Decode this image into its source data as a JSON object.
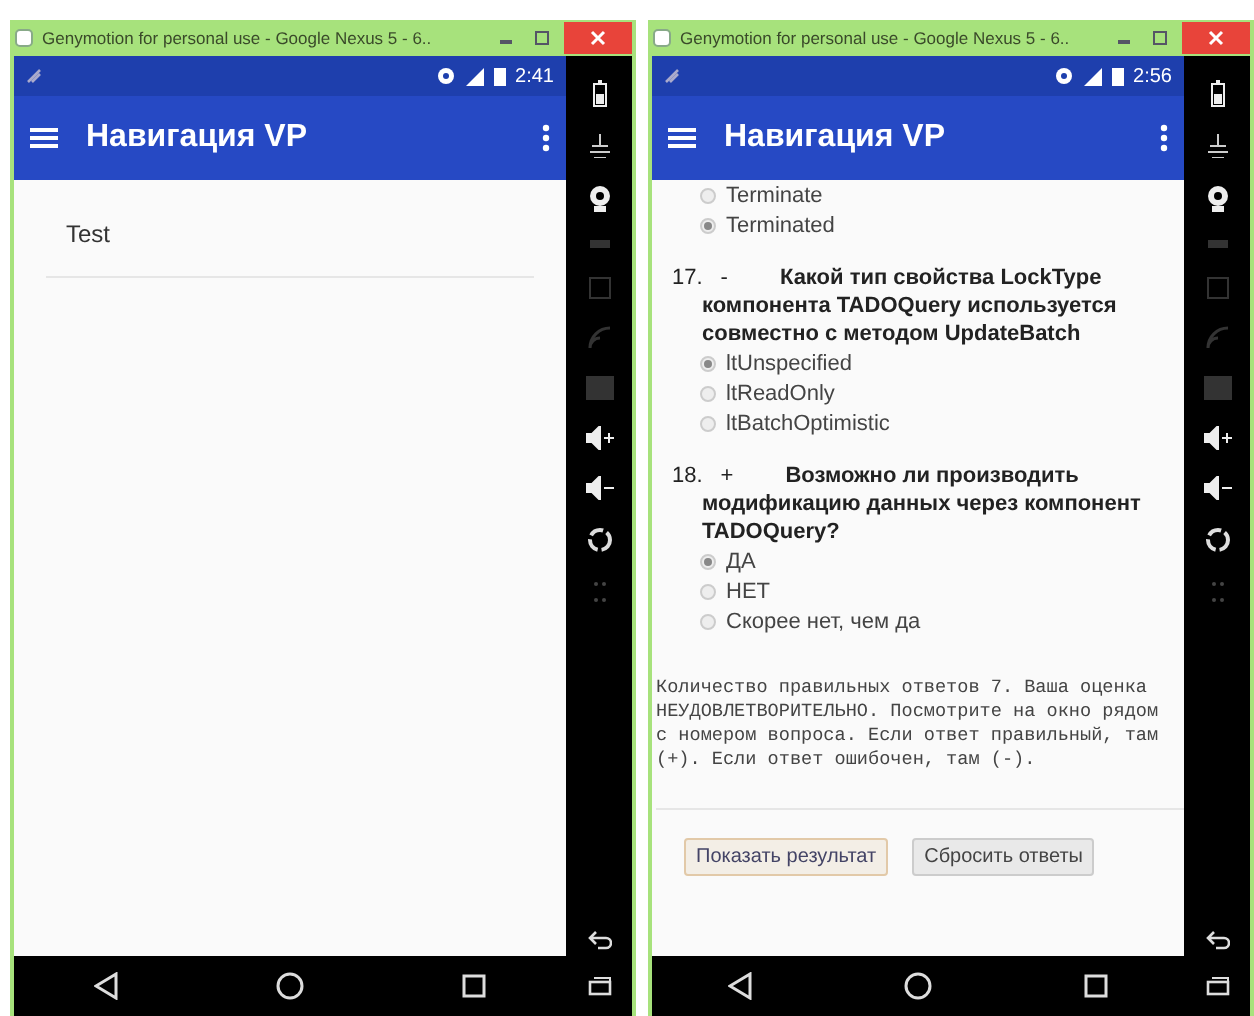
{
  "windows": [
    {
      "title": "Genymotion for personal use - Google Nexus 5 - 6..",
      "status_time": "2:41",
      "app_title": "Навигация VP",
      "content": {
        "kind": "list",
        "items": [
          {
            "label": "Test"
          }
        ]
      }
    },
    {
      "title": "Genymotion for personal use - Google Nexus 5 - 6..",
      "status_time": "2:56",
      "app_title": "Навигация VP",
      "content": {
        "kind": "quiz",
        "options": [
          {
            "label": "Terminate",
            "selected": false
          },
          {
            "label": "Terminated",
            "selected": true
          }
        ],
        "questions": [
          {
            "number": "17.",
            "mark": "-",
            "text": "Какой тип свойства LockType компонента TADOQuery используется совместно с методом UpdateBatch",
            "options": [
              {
                "label": "ltUnspecified",
                "selected": true
              },
              {
                "label": "ltReadOnly",
                "selected": false
              },
              {
                "label": "ltBatchOptimistic",
                "selected": false
              }
            ]
          },
          {
            "number": "18.",
            "mark": "+",
            "text": "Возможно ли производить модификацию данных через компонент TADOQuery?",
            "options": [
              {
                "label": "ДА",
                "selected": true
              },
              {
                "label": "НЕТ",
                "selected": false
              },
              {
                "label": "Скорее нет, чем да",
                "selected": false
              }
            ]
          }
        ],
        "result_lines": [
          "Количество правильных ответов 7. Ваша оценка",
          "НЕУДОВЛЕТВОРИТЕЛЬНО. Посмотрите на окно рядом",
          "с номером вопроса. Если ответ правильный, там",
          "(+). Если ответ ошибочен, там (-)."
        ],
        "buttons": [
          {
            "label": "Показать результат",
            "kind": "primary"
          },
          {
            "label": "Сбросить ответы",
            "kind": "secondary"
          }
        ]
      }
    }
  ]
}
